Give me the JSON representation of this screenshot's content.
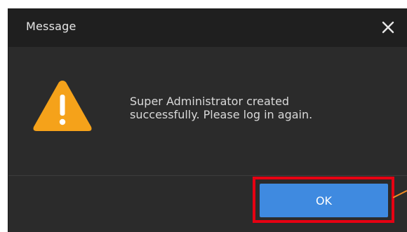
{
  "dialog": {
    "title": "Message",
    "close_icon": "close-icon",
    "warning_icon": "warning-triangle-icon",
    "message_line1": "Super Administrator created",
    "message_line2": "successfully. Please log in again.",
    "ok_label": "OK"
  },
  "colors": {
    "accent": "#3f8ae0",
    "warning": "#f5a21a",
    "highlight": "#e60012",
    "background": "#2b2b2b",
    "titlebar": "#1f1f1f"
  }
}
